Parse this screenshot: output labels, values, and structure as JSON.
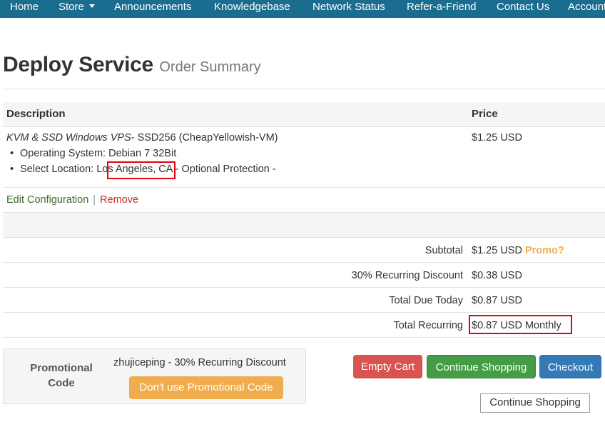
{
  "nav": {
    "home": "Home",
    "store": "Store",
    "announcements": "Announcements",
    "knowledgebase": "Knowledgebase",
    "network_status": "Network Status",
    "refer": "Refer-a-Friend",
    "contact": "Contact Us",
    "account": "Account"
  },
  "header": {
    "title": "Deploy Service",
    "subtitle": "Order Summary"
  },
  "table": {
    "col_description": "Description",
    "col_price": "Price",
    "product_name": "KVM & SSD Windows VPS",
    "product_detail": "- SSD256 (CheapYellowish-VM)",
    "price": "$1.25 USD",
    "option_os": "Operating System: Debian 7 32Bit",
    "option_location_prefix": "Select Location: ",
    "option_location_city": "Los Angeles,",
    "option_location_suffix": " CA - Optional Protection -",
    "edit_link": "Edit Configuration",
    "separator": "|",
    "remove_link": "Remove"
  },
  "summary": {
    "subtotal_label": "Subtotal",
    "subtotal_value": "$1.25 USD",
    "promo_link": "Promo?",
    "discount_label": "30% Recurring Discount",
    "discount_value": "$0.38 USD",
    "due_label": "Total Due Today",
    "due_value": "$0.87 USD",
    "recurring_label": "Total Recurring",
    "recurring_value": "$0.87 USD Monthly"
  },
  "promo": {
    "label_line1": "Promotional",
    "label_line2": "Code",
    "code": "zhujiceping",
    "description": " - 30% Recurring Discount",
    "remove_button": "Don't use Promotional Code"
  },
  "actions": {
    "empty_cart": "Empty Cart",
    "continue_shopping": "Continue Shopping",
    "checkout": "Checkout",
    "continue_shopping_secondary": "Continue Shopping"
  },
  "colors": {
    "navbar": "#1a6d8f",
    "annotation_red": "#e60012",
    "danger": "#d9534f",
    "success": "#449d44",
    "primary": "#337ab7",
    "warning": "#f0ad4e"
  }
}
